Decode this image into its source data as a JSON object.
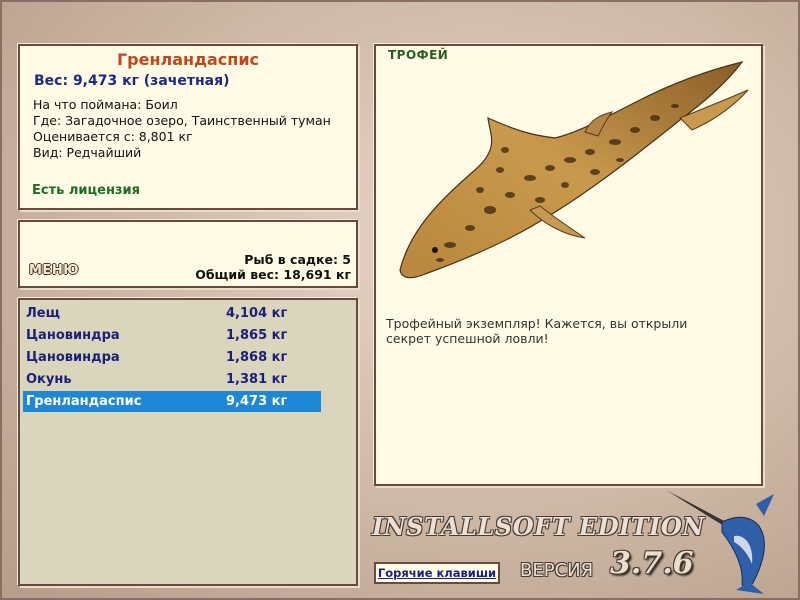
{
  "info": {
    "fish_name": "Гренландаспис",
    "weight_line": "Вес: 9,473 кг (зачетная)",
    "bait_line": "На что поймана: Боил",
    "place_line": "Где: Загадочное озеро, Таинственный туман",
    "rated_line": "Оценивается с: 8,801 кг",
    "kind_line": "Вид: Редчайший",
    "license": "Есть лицензия"
  },
  "menu": {
    "menu_label": "МЕНЮ",
    "fish_count": "Рыб в садке: 5",
    "total_weight": "Общий вес: 18,691 кг"
  },
  "catch_list": [
    {
      "name": "Лещ",
      "weight": "4,104 кг"
    },
    {
      "name": "Цановиндра",
      "weight": "1,865 кг"
    },
    {
      "name": "Цановиндра",
      "weight": "1,868 кг"
    },
    {
      "name": "Окунь",
      "weight": "1,381 кг"
    },
    {
      "name": "Гренландаспис",
      "weight": "9,473 кг"
    }
  ],
  "trophy": {
    "tag": "ТРОФЕЙ",
    "description": "Трофейный экземпляр! Кажется, вы открыли секрет успешной ловли!"
  },
  "footer": {
    "hotkeys": "Горячие клавиши",
    "brand": "INSTALLSOFT EDITION",
    "version_label": "ВЕРСИЯ",
    "version": "3.7.6"
  },
  "colors": {
    "title": "#c0461d",
    "weight": "#1a2a86",
    "license": "#1d6e20",
    "selection": "#1e88d6"
  }
}
